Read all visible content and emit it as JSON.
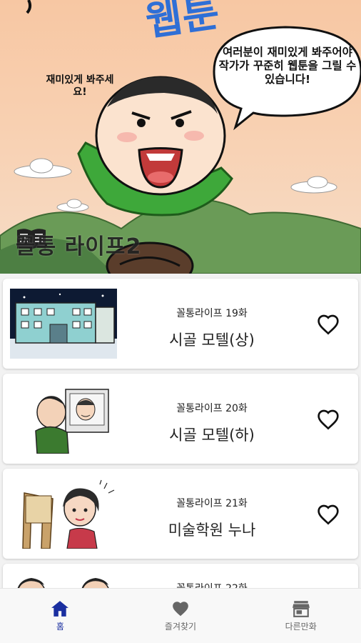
{
  "hero": {
    "speech_right": "여러분이 재미있게 봐주어야 작가가 꾸준히 웹툰을 그릴 수 있습니다!",
    "speech_left": "재미있게 봐주세요!",
    "sign_text": "웹툰",
    "title": "꼴통 라이프2"
  },
  "episodes": [
    {
      "subtitle": "꼴통라이프 19화",
      "title": "시골 모텔(상)",
      "thumb_icon": "motel-building-thumbnail",
      "favorite": false
    },
    {
      "subtitle": "꼴통라이프 20화",
      "title": "시골 모텔(하)",
      "thumb_icon": "man-at-window-thumbnail",
      "favorite": false
    },
    {
      "subtitle": "꼴통라이프 21화",
      "title": "미술학원 누나",
      "thumb_icon": "woman-at-easel-thumbnail",
      "favorite": false
    },
    {
      "subtitle": "꼴통라이프 22화",
      "title": "",
      "thumb_icon": "two-characters-thumbnail",
      "favorite": false
    }
  ],
  "nav": {
    "items": [
      {
        "label": "홈",
        "icon": "home-icon",
        "active": true
      },
      {
        "label": "즐겨찾기",
        "icon": "heart-icon",
        "active": false
      },
      {
        "label": "다른만화",
        "icon": "store-icon",
        "active": false
      }
    ]
  },
  "colors": {
    "accent": "#1a2fa0",
    "hero_sky": "#f7c7a3",
    "shirt_green": "#3ea83a",
    "sign_blue": "#2f6fd6"
  }
}
